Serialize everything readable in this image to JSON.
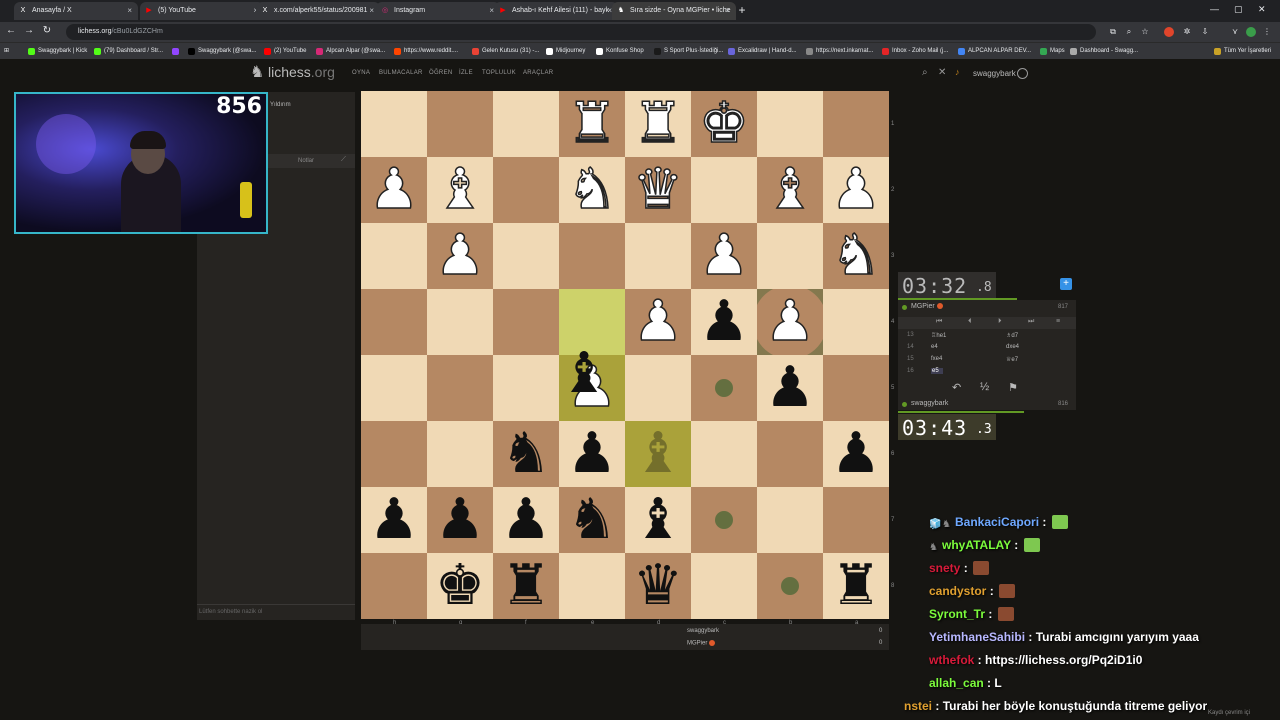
{
  "browser": {
    "tabs": [
      {
        "label": "Anasayfa / X",
        "icon": "X",
        "icon_color": "#000000"
      },
      {
        "label": "(5) YouTube",
        "icon": "▶",
        "icon_color": "#ff0000"
      },
      {
        "label": "x.com/alperk55/status/200981",
        "icon": "X",
        "icon_color": "#000000"
      },
      {
        "label": "Instagram",
        "icon": "◎",
        "icon_color": "#d62976"
      },
      {
        "label": "Ashab-ı Kehf Ailesi (111) - bayk",
        "icon": "▶",
        "icon_color": "#ff0000"
      },
      {
        "label": "Sıra sizde - Oyna MGPier • liche",
        "icon": "♞",
        "icon_color": "#ffffff"
      }
    ],
    "new_tab": "+",
    "url_host": "lichess.org",
    "url_path": "/cBu0LdGZCHm",
    "bookmarks": [
      {
        "label": "Swaggybark | Kick",
        "color": "#53fc18"
      },
      {
        "label": "(79) Dashboard / Str...",
        "color": "#53fc18"
      },
      {
        "label": "",
        "color": "#9146ff"
      },
      {
        "label": "Swaggybark (@swa...",
        "color": "#000000"
      },
      {
        "label": "(2) YouTube",
        "color": "#ff0000"
      },
      {
        "label": "Alpcan Alpar (@swa...",
        "color": "#d62976"
      },
      {
        "label": "https://www.reddit....",
        "color": "#ff4500"
      },
      {
        "label": "Gelen Kutusu (31) -...",
        "color": "#ea4335"
      },
      {
        "label": "Midjourney",
        "color": "#ffffff"
      },
      {
        "label": "Konfuse Shop",
        "color": "#ffffff"
      },
      {
        "label": "S Sport Plus·İstediği...",
        "color": "#1a1a1a"
      },
      {
        "label": "Excalidraw | Hand-d...",
        "color": "#6965db"
      },
      {
        "label": "https://next.inkarnat...",
        "color": "#888888"
      },
      {
        "label": "Inbox - Zoho Mail (j...",
        "color": "#e42527"
      },
      {
        "label": "ALPCAN ALPAR DEV...",
        "color": "#4285f4"
      },
      {
        "label": "Maps",
        "color": "#34a853"
      },
      {
        "label": "Dashboard - Swagg...",
        "color": "#aaaaaa"
      }
    ],
    "all_bookmarks": "Tüm Yer İşaretleri"
  },
  "lichess": {
    "logo_main": "lichess",
    "logo_tld": ".org",
    "nav": [
      "OYNA",
      "BULMACALAR",
      "ÖĞREN",
      "İZLE",
      "TOPLULUK",
      "ARAÇLAR"
    ],
    "username": "swaggybark"
  },
  "left_panel": {
    "title": "Yıldırım",
    "notes_tab": "Notlar",
    "chat_placeholder": "Lütfen sohbette nazik ol"
  },
  "webcam": {
    "rating_overlay": "856"
  },
  "board": {
    "files": [
      "h",
      "g",
      "f",
      "e",
      "d",
      "c",
      "b",
      "a"
    ],
    "ranks": [
      "1",
      "2",
      "3",
      "4",
      "5",
      "6",
      "7",
      "8"
    ],
    "pieces": [
      {
        "c": 3,
        "r": 0,
        "color": "w",
        "glyph": "♜",
        "type": "rook"
      },
      {
        "c": 4,
        "r": 0,
        "color": "w",
        "glyph": "♜",
        "type": "rook"
      },
      {
        "c": 5,
        "r": 0,
        "color": "w",
        "glyph": "♚",
        "type": "king"
      },
      {
        "c": 0,
        "r": 1,
        "color": "w",
        "glyph": "♟",
        "type": "pawn"
      },
      {
        "c": 1,
        "r": 1,
        "color": "w",
        "glyph": "♝",
        "type": "bishop"
      },
      {
        "c": 3,
        "r": 1,
        "color": "w",
        "glyph": "♞",
        "type": "knight"
      },
      {
        "c": 4,
        "r": 1,
        "color": "w",
        "glyph": "♛",
        "type": "queen"
      },
      {
        "c": 6,
        "r": 1,
        "color": "w",
        "glyph": "♝",
        "type": "bishop"
      },
      {
        "c": 7,
        "r": 1,
        "color": "w",
        "glyph": "♟",
        "type": "pawn"
      },
      {
        "c": 1,
        "r": 2,
        "color": "w",
        "glyph": "♟",
        "type": "pawn"
      },
      {
        "c": 5,
        "r": 2,
        "color": "w",
        "glyph": "♟",
        "type": "pawn"
      },
      {
        "c": 7,
        "r": 2,
        "color": "w",
        "glyph": "♞",
        "type": "knight"
      },
      {
        "c": 4,
        "r": 3,
        "color": "w",
        "glyph": "♟",
        "type": "pawn"
      },
      {
        "c": 5,
        "r": 3,
        "color": "b",
        "glyph": "♟",
        "type": "pawn"
      },
      {
        "c": 6,
        "r": 3,
        "color": "w",
        "glyph": "♟",
        "type": "pawn"
      },
      {
        "c": 3,
        "r": 4,
        "color": "w",
        "glyph": "♟",
        "type": "pawn"
      },
      {
        "c": 6,
        "r": 4,
        "color": "b",
        "glyph": "♟",
        "type": "pawn"
      },
      {
        "c": 2,
        "r": 5,
        "color": "b",
        "glyph": "♞",
        "type": "knight"
      },
      {
        "c": 3,
        "r": 5,
        "color": "b",
        "glyph": "♟",
        "type": "pawn"
      },
      {
        "c": 7,
        "r": 5,
        "color": "b",
        "glyph": "♟",
        "type": "pawn"
      },
      {
        "c": 0,
        "r": 6,
        "color": "b",
        "glyph": "♟",
        "type": "pawn"
      },
      {
        "c": 1,
        "r": 6,
        "color": "b",
        "glyph": "♟",
        "type": "pawn"
      },
      {
        "c": 2,
        "r": 6,
        "color": "b",
        "glyph": "♟",
        "type": "pawn"
      },
      {
        "c": 3,
        "r": 6,
        "color": "b",
        "glyph": "♞",
        "type": "knight"
      },
      {
        "c": 4,
        "r": 6,
        "color": "b",
        "glyph": "♝",
        "type": "bishop"
      },
      {
        "c": 1,
        "r": 7,
        "color": "b",
        "glyph": "♚",
        "type": "king"
      },
      {
        "c": 2,
        "r": 7,
        "color": "b",
        "glyph": "♜",
        "type": "rook"
      },
      {
        "c": 4,
        "r": 7,
        "color": "b",
        "glyph": "♛",
        "type": "queen"
      },
      {
        "c": 7,
        "r": 7,
        "color": "b",
        "glyph": "♜",
        "type": "rook"
      }
    ],
    "dragging_piece": {
      "c": 3,
      "r": 4,
      "color": "b",
      "glyph": "♝",
      "type": "bishop"
    },
    "ghost_piece": {
      "c": 4,
      "r": 5,
      "color": "b",
      "glyph": "♝",
      "type": "bishop"
    },
    "highlights": [
      {
        "c": 3,
        "r": 3
      },
      {
        "c": 3,
        "r": 4
      },
      {
        "c": 4,
        "r": 5
      }
    ],
    "move_dots": [
      {
        "c": 5,
        "r": 4
      },
      {
        "c": 5,
        "r": 6
      },
      {
        "c": 6,
        "r": 7
      }
    ],
    "capture_rings": [
      {
        "c": 6,
        "r": 3
      }
    ],
    "light_color": "#f0d9b5",
    "dark_color": "#b58863"
  },
  "below_board": {
    "players": [
      {
        "name": "swaggybark",
        "score": "0"
      },
      {
        "name": "MGPier",
        "score": "0"
      }
    ]
  },
  "game": {
    "top_clock_main": "03:32",
    "top_clock_frac": ".8",
    "bottom_clock_main": "03:43",
    "bottom_clock_frac": ".3",
    "top_player": "MGPier",
    "top_rating": "817",
    "bottom_player": "swaggybark",
    "bottom_rating": "816",
    "top_time_fraction": 0.67,
    "bottom_time_fraction": 0.71,
    "moves": [
      {
        "n": "13",
        "w": "♖he1",
        "b": "♗d7"
      },
      {
        "n": "14",
        "w": "e4",
        "b": "dxe4"
      },
      {
        "n": "15",
        "w": "fxe4",
        "b": "♕e7"
      },
      {
        "n": "16",
        "w": "e5",
        "b": ""
      }
    ],
    "current_move_index": 3,
    "draw_label": "½"
  },
  "chat": [
    {
      "user": "BankaciCapori",
      "msg": "",
      "color": "#6fa8ff",
      "emote": "#7ec850",
      "badge": "🧊"
    },
    {
      "user": "whyATALAY",
      "msg": "",
      "color": "#7cfc3c",
      "emote": "#7ec850",
      "badge": ""
    },
    {
      "user": "snety",
      "msg": "",
      "color": "#d81b3a",
      "emote": "#8a4a30",
      "badge": ""
    },
    {
      "user": "candystor",
      "msg": "",
      "color": "#e0a030",
      "emote": "#8a4a30",
      "badge": ""
    },
    {
      "user": "Syront_Tr",
      "msg": "",
      "color": "#7cfc3c",
      "emote": "#8a4a30",
      "badge": ""
    },
    {
      "user": "YetimhaneSahibi",
      "msg": "Turabi amcıgını yarıyım yaaa",
      "color": "#b8b8ff",
      "emote": "",
      "badge": ""
    },
    {
      "user": "wthefok",
      "msg": "https://lichess.org/Pq2iD1i0",
      "color": "#d81b3a",
      "emote": "",
      "badge": ""
    },
    {
      "user": "allah_can",
      "msg": "L",
      "color": "#7cfc3c",
      "emote": "",
      "badge": ""
    },
    {
      "user": "nstei",
      "msg": "Turabi her böyle konuştuğunda titreme geliyor",
      "color": "#e0a030",
      "emote": "",
      "badge": ""
    }
  ],
  "chat_footer": "Kaydı çevrim içi"
}
